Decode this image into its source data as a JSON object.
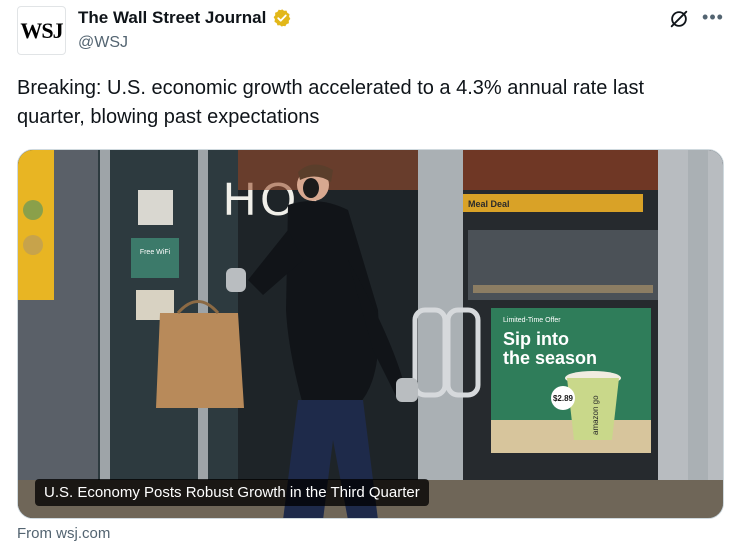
{
  "account": {
    "avatar_text": "WSJ",
    "name": "The Wall Street Journal",
    "handle": "@WSJ",
    "verified_color": "#e2b719"
  },
  "tweet": {
    "text": "Breaking: U.S. economic growth accelerated to a 4.3% annual rate last quarter, blowing past expectations"
  },
  "card": {
    "headline": "U.S. Economy Posts Robust Growth in the Third Quarter",
    "source": "From wsj.com",
    "scene": {
      "store_sign": "HOT",
      "shelf_sign": "Meal Deal",
      "poster_label": "Limited-Time Offer",
      "poster_title_1": "Sip into",
      "poster_title_2": "the season",
      "poster_price": "$2.89",
      "poster_brand": "amazon go",
      "wifi_sign": "Free WiFi"
    }
  },
  "icons": {
    "grok": "grok-icon",
    "more": "more-icon",
    "verified": "verified-badge-icon"
  },
  "colors": {
    "text_primary": "#0f1419",
    "text_secondary": "#536471",
    "poster_green": "#2f7d5a"
  }
}
